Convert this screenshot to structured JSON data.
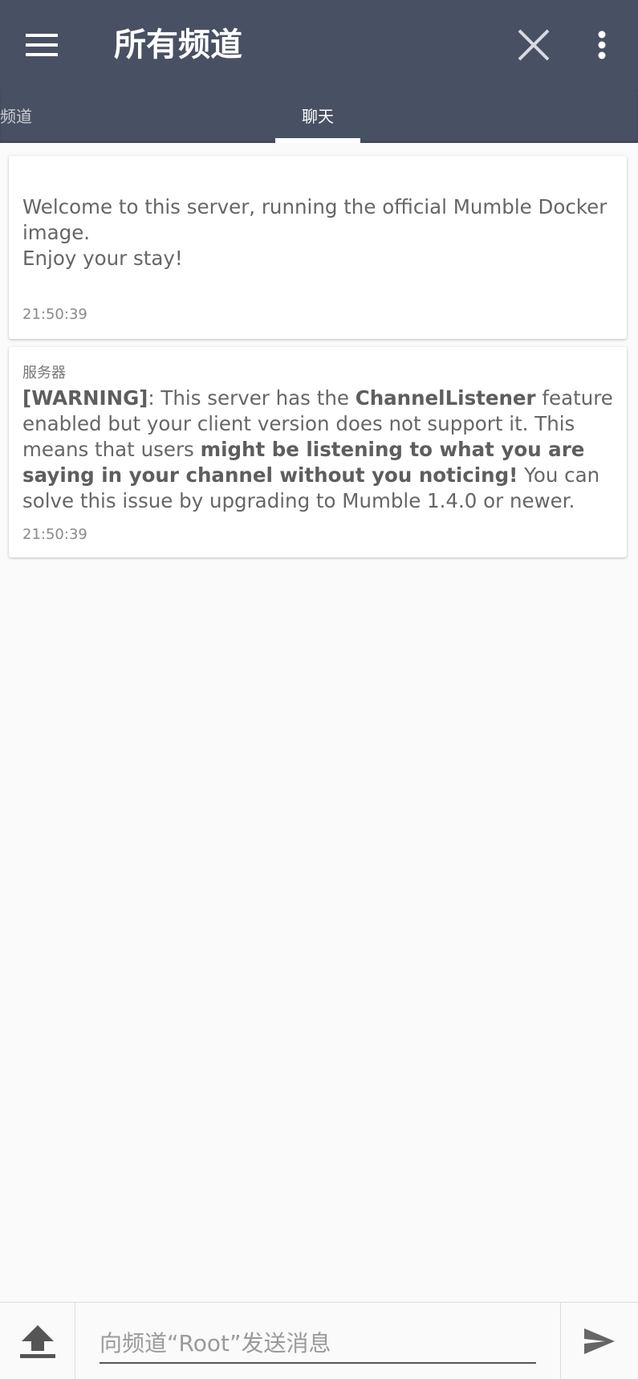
{
  "appbar": {
    "title": "所有频道",
    "menu_icon": "hamburger-menu-icon",
    "close_icon": "close-icon",
    "more_icon": "more-vert-icon"
  },
  "tabs": [
    {
      "label": "频道",
      "selected": false
    },
    {
      "label": "聊天",
      "selected": true
    }
  ],
  "messages": [
    {
      "sender": "",
      "line1": "Welcome to this server, running the official Mumble Docker image.",
      "line2": "Enjoy your stay!",
      "time": "21:50:39"
    },
    {
      "sender": "服务器",
      "parts": {
        "p1": "[WARNING]",
        "p2": ": This server has the ",
        "p3": "ChannelListener",
        "p4": " feature enabled but your client version does not support it. This means that users ",
        "p5": "might be listening to what you are saying in your channel without you noticing!",
        "p6": " You can solve this issue by upgrading to Mumble 1.4.0 or newer."
      },
      "time": "21:50:39"
    }
  ],
  "composer": {
    "placeholder": "向频道“Root”发送消息",
    "value": "",
    "upload_icon": "upload-icon",
    "send_icon": "send-icon"
  },
  "colors": {
    "appbar": "#485063",
    "background": "#fafafa",
    "card": "#ffffff"
  }
}
